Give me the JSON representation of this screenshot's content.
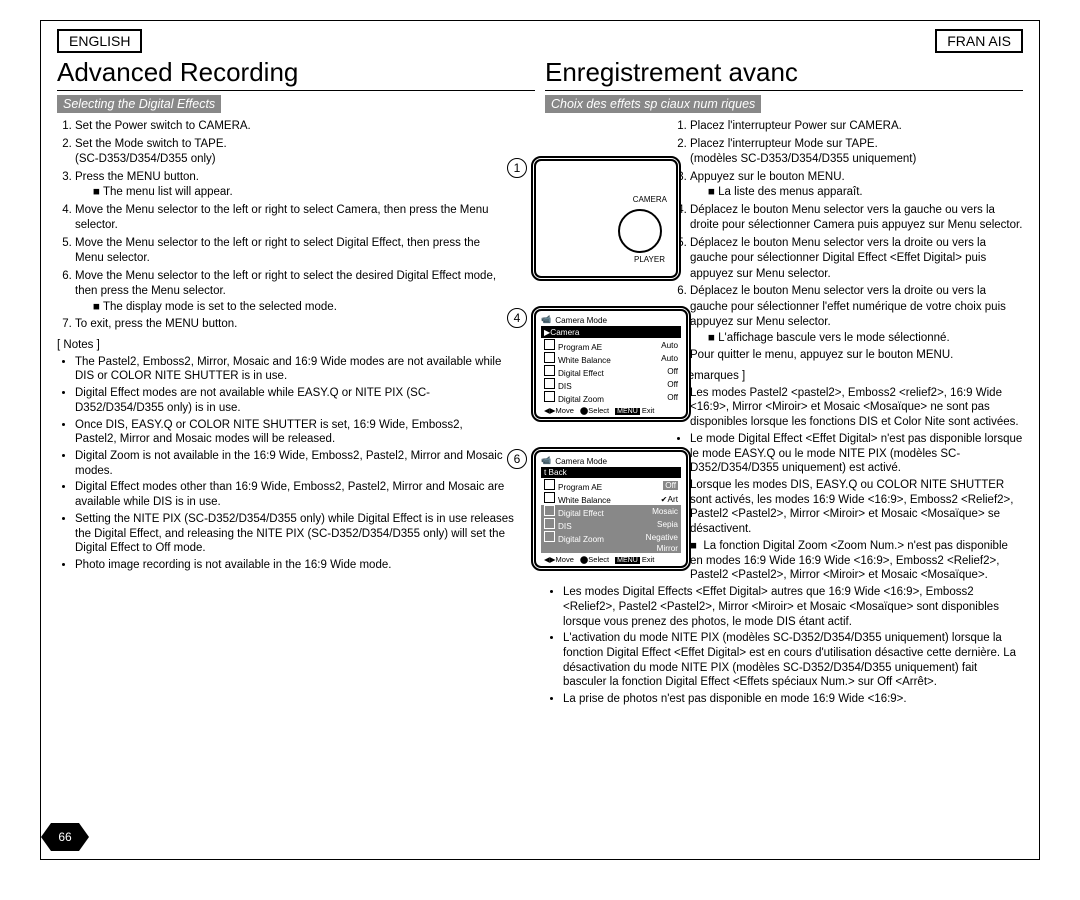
{
  "lang_en": "ENGLISH",
  "lang_fr": "FRAN AIS",
  "title_en": "Advanced Recording",
  "title_fr": "Enregistrement avanc",
  "sub_en": "Selecting the Digital Effects",
  "sub_fr": "Choix des effets sp ciaux num riques",
  "en_steps": {
    "s1": "Set the Power switch to CAMERA.",
    "s2": "Set the Mode switch to TAPE.",
    "s2b": "(SC-D353/D354/D355 only)",
    "s3": "Press the MENU button.",
    "s3b": "The menu list will appear.",
    "s4": "Move the Menu selector to the left or right to select Camera, then press the Menu selector.",
    "s5": "Move the Menu selector to the left or right to select Digital Effect, then press the Menu selector.",
    "s6": "Move the Menu selector to the left or right to select the desired Digital Effect mode, then press the Menu selector.",
    "s6b": "The display mode is set to the selected mode.",
    "s7": "To exit, press the MENU button."
  },
  "en_notes_head": "[ Notes ]",
  "en_notes": {
    "n1": "The Pastel2, Emboss2, Mirror, Mosaic and 16:9 Wide modes are not available while DIS or COLOR NITE SHUTTER is in use.",
    "n2": "Digital Effect modes are not available while EASY.Q or NITE PIX (SC-D352/D354/D355 only) is in use.",
    "n3": "Once DIS, EASY.Q or COLOR NITE SHUTTER is set, 16:9 Wide, Emboss2, Pastel2, Mirror and Mosaic modes will be released.",
    "n4": "Digital Zoom is not available in the 16:9 Wide, Emboss2, Pastel2, Mirror and Mosaic modes.",
    "n5": "Digital Effect modes other than 16:9 Wide, Emboss2, Pastel2, Mirror and Mosaic are available while DIS is in use.",
    "n6": "Setting the NITE PIX (SC-D352/D354/D355 only) while Digital Effect is in use releases the Digital Effect, and releasing the NITE PIX (SC-D352/D354/D355 only) will set the Digital Effect to Off mode.",
    "n7": "Photo image recording is not available in the 16:9 Wide mode."
  },
  "fr_steps": {
    "s1": "Placez l'interrupteur Power sur CAMERA.",
    "s2": "Placez l'interrupteur Mode sur TAPE.",
    "s2b": "(modèles SC-D353/D354/D355 uniquement)",
    "s3": "Appuyez sur le bouton MENU.",
    "s3b": "La liste des menus apparaît.",
    "s4": "Déplacez le bouton Menu selector vers la gauche ou vers la droite pour sélectionner Camera puis appuyez sur Menu selector.",
    "s5": "Déplacez le bouton Menu selector vers la droite ou vers la gauche pour sélectionner Digital Effect <Effet Digital> puis appuyez sur Menu selector.",
    "s6": "Déplacez le bouton Menu selector vers la droite ou vers la gauche pour sélectionner l'effet numérique de votre choix puis appuyez sur Menu selector.",
    "s6b": "L'affichage bascule vers le mode sélectionné.",
    "s7": "Pour quitter le menu, appuyez sur le bouton MENU."
  },
  "fr_notes_head": "[ Remarques ]",
  "fr_notes": {
    "n1": "Les modes Pastel2 <pastel2>, Emboss2 <relief2>, 16:9 Wide <16:9>, Mirror <Miroir> et Mosaic <Mosaïque> ne sont pas disponibles lorsque les fonctions DIS et Color Nite sont activées.",
    "n2": "Le mode Digital Effect <Effet Digital> n'est pas disponible lorsque le mode EASY.Q ou le mode NITE PIX (modèles SC-D352/D354/D355 uniquement) est activé.",
    "n3": "Lorsque les modes DIS, EASY.Q ou COLOR NITE SHUTTER sont activés, les modes 16:9 Wide <16:9>, Emboss2 <Relief2>, Pastel2 <Pastel2>, Mirror <Miroir> et Mosaic <Mosaïque> se désactivent.",
    "n4": "La fonction Digital Zoom <Zoom Num.> n'est pas disponible en modes 16:9 Wide 16:9 Wide <16:9>, Emboss2 <Relief2>, Pastel2 <Pastel2>, Mirror <Miroir> et Mosaic <Mosaïque>.",
    "n5": "Les modes Digital Effects <Effet Digital> autres que 16:9 Wide <16:9>, Emboss2 <Relief2>, Pastel2 <Pastel2>, Mirror <Miroir> et Mosaic <Mosaïque> sont disponibles lorsque vous prenez des photos, le mode DIS étant actif.",
    "n6": "L'activation du mode NITE PIX (modèles SC-D352/D354/D355 uniquement) lorsque la fonction Digital Effect <Effet Digital> est en cours d'utilisation désactive cette dernière. La désactivation du mode NITE PIX (modèles SC-D352/D354/D355 uniquement) fait basculer la fonction Digital Effect <Effets spéciaux Num.> sur Off <Arrêt>.",
    "n7": "La prise de photos n'est pas disponible en mode 16:9 Wide <16:9>."
  },
  "circ1": "1",
  "circ4": "4",
  "circ6": "6",
  "cam_label_c": "CAMERA",
  "cam_label_p": "PLAYER",
  "menu4": {
    "title": "Camera Mode",
    "back": "Camera",
    "rows": [
      {
        "k": "Program AE",
        "v": "Auto"
      },
      {
        "k": "White Balance",
        "v": "Auto"
      },
      {
        "k": "Digital Effect",
        "v": "Off"
      },
      {
        "k": "DIS",
        "v": "Off"
      },
      {
        "k": "Digital Zoom",
        "v": "Off"
      }
    ],
    "foot": {
      "move": "Move",
      "select": "Select",
      "exit": "Exit",
      "menu": "MENU"
    }
  },
  "menu6": {
    "title": "Camera Mode",
    "back": "t Back",
    "rows": [
      {
        "k": "Program AE",
        "v": "Off"
      },
      {
        "k": "White Balance",
        "v": "✔Art"
      },
      {
        "k": "Digital Effect",
        "v": "Mosaic"
      },
      {
        "k": "DIS",
        "v": "Sepia"
      },
      {
        "k": "Digital Zoom",
        "v": "Negative"
      },
      {
        "k": "",
        "v": "Mirror"
      }
    ],
    "foot": {
      "move": "Move",
      "select": "Select",
      "exit": "Exit",
      "menu": "MENU"
    }
  },
  "page_num": "66"
}
